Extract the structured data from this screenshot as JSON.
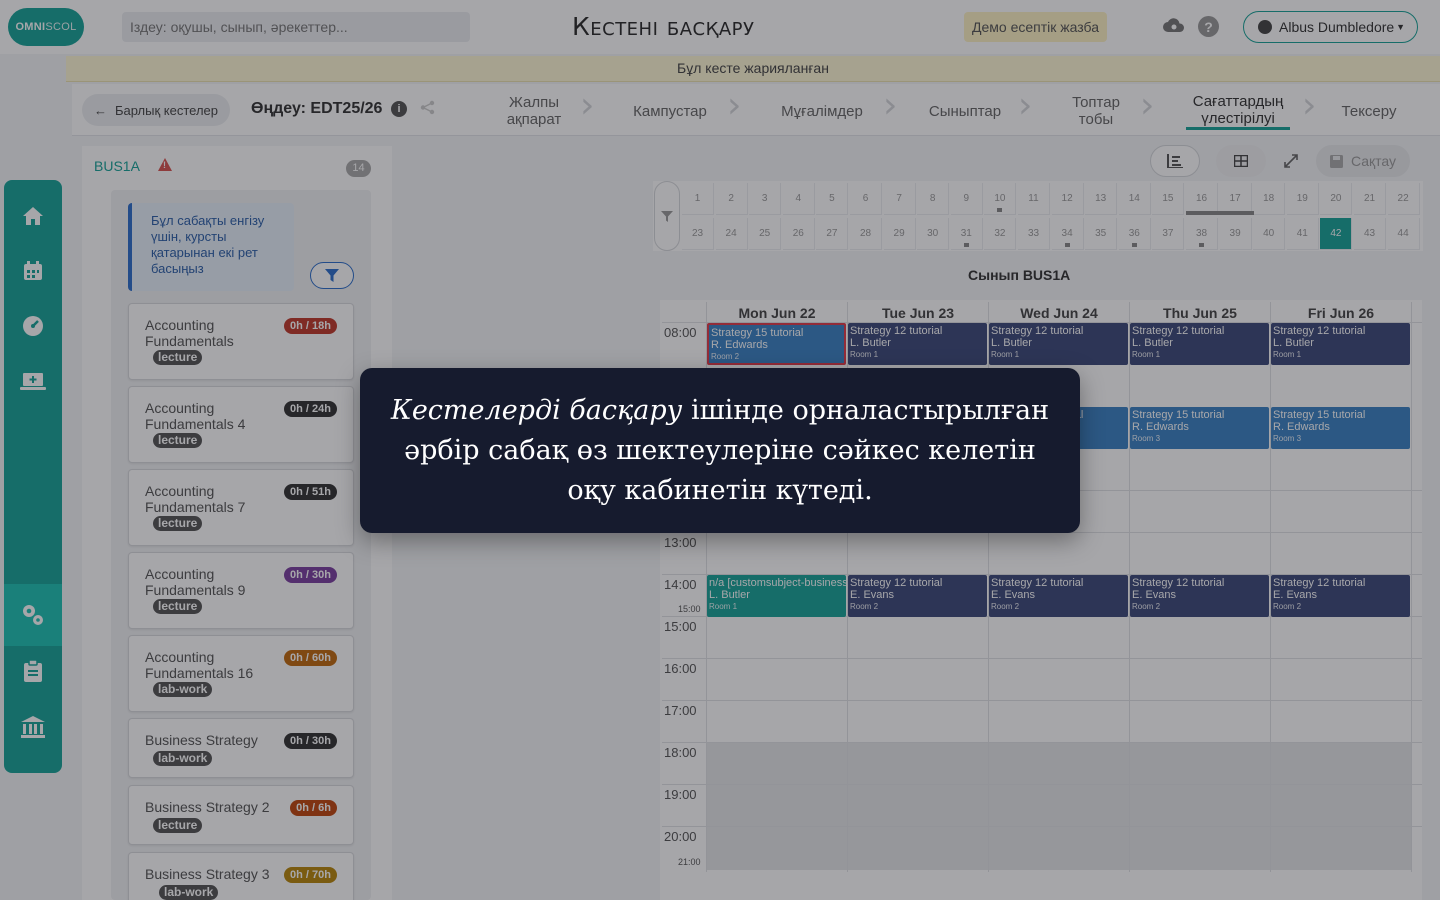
{
  "header": {
    "logo": {
      "part1": "OMNI",
      "part2": "SCOL"
    },
    "search_placeholder": "Іздеу: оқушы, сынып, әрекеттер...",
    "title": "Кестені басқару",
    "demo_badge": "Демо есептік жазба",
    "help_glyph": "?",
    "user_name": "Albus Dumbledore"
  },
  "banner": "Бұл кесте жарияланған",
  "subheader": {
    "back_label": "Барлық кестелер",
    "edit_label": "Өңдеу: EDT25/26",
    "info_glyph": "i",
    "steps": [
      {
        "label": "Жалпы ақпарат"
      },
      {
        "label": "Кампустар"
      },
      {
        "label": "Мұғалімдер"
      },
      {
        "label": "Сыныптар"
      },
      {
        "label": "Топтар тобы"
      },
      {
        "label": "Сағаттардың үлестірілуі"
      },
      {
        "label": "Тексеру"
      }
    ],
    "active_step": "Сағаттардың үлестірілуі"
  },
  "left_panel": {
    "class_name": "BUS1A",
    "warning_glyph": "!",
    "count": "14",
    "hint": "Бұл сабақты енгізу үшін, курсты қатарынан екі рет басыңыз",
    "subjects": [
      {
        "name": "Accounting Fundamentals",
        "hours": "0h / 18h",
        "type": "lecture",
        "color": "#c0392b"
      },
      {
        "name": "Accounting Fundamentals 4",
        "hours": "0h / 24h",
        "type": "lecture",
        "color": "#333333"
      },
      {
        "name": "Accounting Fundamentals 7",
        "hours": "0h / 51h",
        "type": "lecture",
        "color": "#333333"
      },
      {
        "name": "Accounting Fundamentals 9",
        "hours": "0h / 30h",
        "type": "lecture",
        "color": "#7b3fa0"
      },
      {
        "name": "Accounting Fundamentals 16",
        "hours": "0h / 60h",
        "type": "lab-work",
        "color": "#c06a0e"
      },
      {
        "name": "Business Strategy",
        "hours": "0h / 30h",
        "type": "lab-work",
        "color": "#333333"
      },
      {
        "name": "Business Strategy 2",
        "hours": "0h / 6h",
        "type": "lecture",
        "color": "#c0460e"
      },
      {
        "name": "Business Strategy 3",
        "hours": "0h / 70h",
        "type": "lab-work",
        "color": "#b8860b"
      }
    ]
  },
  "toolbar": {
    "save_label": "Сақтау"
  },
  "weeks": {
    "row1": [
      "1",
      "2",
      "3",
      "4",
      "5",
      "6",
      "7",
      "8",
      "9",
      "10",
      "11",
      "12",
      "13",
      "14",
      "15",
      "16",
      "17",
      "18",
      "19",
      "20",
      "21",
      "22"
    ],
    "row2": [
      "23",
      "24",
      "25",
      "26",
      "27",
      "28",
      "29",
      "30",
      "31",
      "32",
      "33",
      "34",
      "35",
      "36",
      "37",
      "38",
      "39",
      "40",
      "41",
      "42",
      "43",
      "44"
    ],
    "current": "42"
  },
  "calendar": {
    "group_label": "Сынып BUS1A",
    "days": [
      "Mon Jun 22",
      "Tue Jun 23",
      "Wed Jun 24",
      "Thu Jun 25",
      "Fri Jun 26"
    ],
    "hours": [
      "08:00",
      "13:00",
      "14:00",
      "15:00",
      "16:00",
      "17:00",
      "18:00",
      "19:00",
      "20:00"
    ],
    "small_times": [
      "15:00",
      "21:00"
    ],
    "events": [
      {
        "day": 0,
        "row": "r08",
        "subject": "Strategy 15  tutorial",
        "teacher": "R. Edwards",
        "room": "Room 2",
        "color": "blue",
        "selected": true
      },
      {
        "day": 1,
        "row": "r08",
        "subject": "Strategy 12  tutorial",
        "teacher": "L. Butler",
        "room": "Room 1",
        "color": "navy"
      },
      {
        "day": 2,
        "row": "r08",
        "subject": "Strategy 12  tutorial",
        "teacher": "L. Butler",
        "room": "Room 1",
        "color": "navy"
      },
      {
        "day": 3,
        "row": "r08",
        "subject": "Strategy 12  tutorial",
        "teacher": "L. Butler",
        "room": "Room 1",
        "color": "navy"
      },
      {
        "day": 4,
        "row": "r08",
        "subject": "Strategy 12  tutorial",
        "teacher": "L. Butler",
        "room": "Room 1",
        "color": "navy"
      },
      {
        "day": 2,
        "row": "r10",
        "subject": "Strategy 15  tutorial",
        "teacher": "R. Edwards",
        "room": "Room 3",
        "color": "blue"
      },
      {
        "day": 3,
        "row": "r10",
        "subject": "Strategy 15  tutorial",
        "teacher": "R. Edwards",
        "room": "Room 3",
        "color": "blue"
      },
      {
        "day": 4,
        "row": "r10",
        "subject": "Strategy 15  tutorial",
        "teacher": "R. Edwards",
        "room": "Room 3",
        "color": "blue"
      },
      {
        "day": 0,
        "row": "r14",
        "subject": "n/a [customsubject-business]",
        "teacher": "L. Butler",
        "room": "Room 1",
        "color": "teal"
      },
      {
        "day": 1,
        "row": "r14",
        "subject": "Strategy 12  tutorial",
        "teacher": "E. Evans",
        "room": "Room 2",
        "color": "navy"
      },
      {
        "day": 2,
        "row": "r14",
        "subject": "Strategy 12  tutorial",
        "teacher": "E. Evans",
        "room": "Room 2",
        "color": "navy"
      },
      {
        "day": 3,
        "row": "r14",
        "subject": "Strategy 12  tutorial",
        "teacher": "E. Evans",
        "room": "Room 2",
        "color": "navy"
      },
      {
        "day": 4,
        "row": "r14",
        "subject": "Strategy 12  tutorial",
        "teacher": "E. Evans",
        "room": "Room 2",
        "color": "navy"
      }
    ]
  },
  "tooltip": {
    "emphasis": "Кестелерді басқару",
    "text": " ішінде орналастырылған әрбір сабақ өз шектеулеріне сәйкес келетін оқу кабинетін күтеді."
  },
  "colors": {
    "accent": "#17a398",
    "tooltip_bg": "#161b2e"
  }
}
